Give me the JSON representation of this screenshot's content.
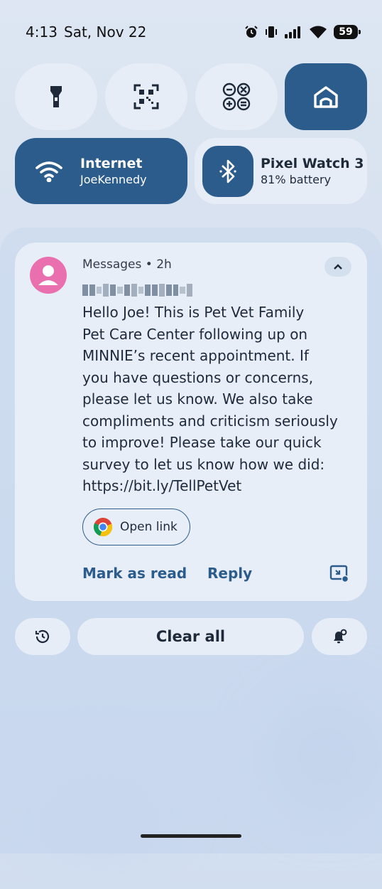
{
  "status_bar": {
    "time": "4:13",
    "date": "Sat, Nov 22",
    "battery_level": "59",
    "icons": [
      "alarm-icon",
      "vibrate-icon",
      "signal-icon",
      "wifi-icon",
      "battery-icon"
    ]
  },
  "quick_tiles": {
    "small": [
      {
        "icon": "flashlight-icon",
        "active": false
      },
      {
        "icon": "qr-code-scanner-icon",
        "active": false
      },
      {
        "icon": "calculator-icon",
        "active": false
      },
      {
        "icon": "home-icon",
        "active": true
      }
    ],
    "internet": {
      "title": "Internet",
      "subtitle": "JoeKennedy",
      "icon": "wifi-icon",
      "active": true
    },
    "watch": {
      "title": "Pixel Watch 3",
      "subtitle": "81% battery",
      "icon": "bluetooth-icon",
      "active": false
    }
  },
  "notification": {
    "app_meta": "Messages • 2h",
    "avatar_icon": "person-icon",
    "sender": "redacted",
    "body": "Hello Joe! This is Pet Vet Family\nPet Care Center following up on\nMINNIE’s recent appointment.  If\nyou have questions or concerns,\nplease let us know.  We also take\ncompliments and criticism seriously\nto improve!  Please take our quick\nsurvey to let us know how we did:\nhttps://bit.ly/TellPetVet",
    "open_link_label": "Open link",
    "actions": {
      "mark_read": "Mark as read",
      "reply": "Reply"
    }
  },
  "bottom_bar": {
    "clear_all": "Clear all",
    "history_icon": "history-icon",
    "settings_icon": "notification-settings-icon"
  },
  "colors": {
    "accent": "#2b5c8c",
    "tile_bg": "#e6edf7",
    "avatar": "#e96fae"
  }
}
